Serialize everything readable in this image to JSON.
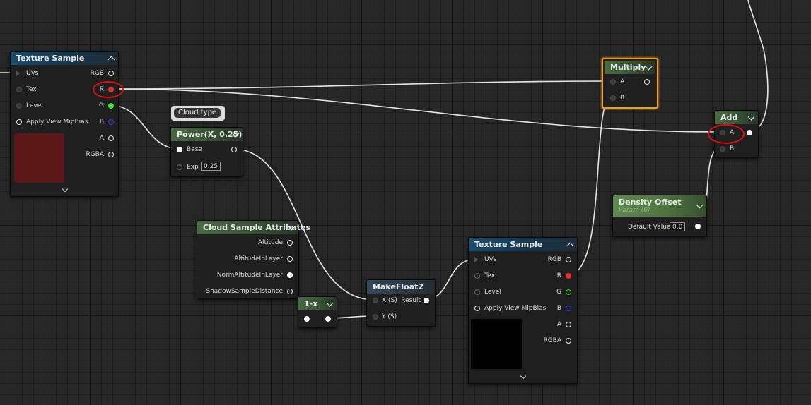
{
  "nodes": {
    "texture_sample_1": {
      "title": "Texture Sample",
      "inputs": [
        "UVs",
        "Tex",
        "Level",
        "Apply View MipBias"
      ],
      "outputs": [
        "RGB",
        "R",
        "G",
        "B",
        "A",
        "RGBA"
      ],
      "preview_color": "#5a1616"
    },
    "power": {
      "title": "Power(X, 0.25)",
      "comment": "Cloud type",
      "inputs": [
        "Base",
        "Exp"
      ],
      "exp_value": "0.25"
    },
    "cloud_sample_attributes": {
      "title": "Cloud Sample Attributes",
      "outputs": [
        "Altitude",
        "AltitudeInLayer",
        "NormAltitudeInLayer",
        "ShadowSampleDistance"
      ]
    },
    "one_minus_x": {
      "title": "1-x"
    },
    "makefloat2": {
      "title": "MakeFloat2",
      "inputs": [
        "X (S)",
        "Y (S)"
      ],
      "output": "Result"
    },
    "texture_sample_2": {
      "title": "Texture Sample",
      "inputs": [
        "UVs",
        "Tex",
        "Level",
        "Apply View MipBias"
      ],
      "outputs": [
        "RGB",
        "R",
        "G",
        "B",
        "A",
        "RGBA"
      ],
      "preview_color": "#000000"
    },
    "multiply": {
      "title": "Multiply",
      "inputs": [
        "A",
        "B"
      ]
    },
    "density_offset": {
      "title": "Density Offset",
      "subtitle": "Param (0)",
      "param_label": "Default Value",
      "param_value": "0.0"
    },
    "add": {
      "title": "Add",
      "inputs": [
        "A",
        "B"
      ]
    }
  },
  "colors": {
    "grid_background": "#262626",
    "selection_outline": "#f29d1f",
    "annotation_circle": "#e01010",
    "pin_red": "#e53030",
    "pin_green": "#35e02e",
    "pin_blue": "#2c3cff",
    "wire": "#e6e6e6"
  },
  "icons": {
    "collapse": "chevron-up-icon",
    "dropdown": "chevron-down-icon",
    "expand": "chevron-down-icon"
  }
}
